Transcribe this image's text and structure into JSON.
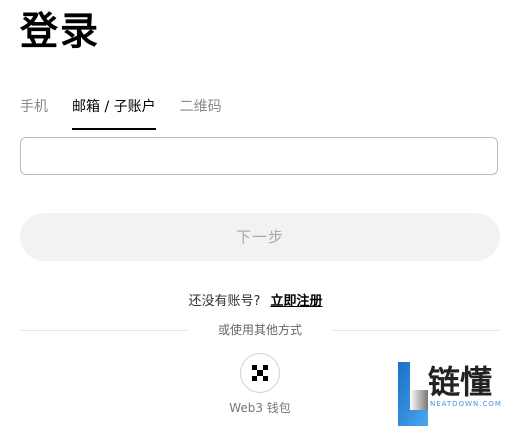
{
  "page": {
    "title": "登录"
  },
  "tabs": [
    {
      "label": "手机",
      "active": false
    },
    {
      "label": "邮箱 / 子账户",
      "active": true
    },
    {
      "label": "二维码",
      "active": false
    }
  ],
  "input": {
    "value": "",
    "placeholder": ""
  },
  "next_button": {
    "label": "下一步",
    "disabled": true
  },
  "register": {
    "prompt": "还没有账号?",
    "link_label": "立即注册"
  },
  "divider": {
    "label": "或使用其他方式"
  },
  "web3_wallet": {
    "icon": "web3-wallet-icon",
    "label": "Web3 钱包"
  },
  "watermark": {
    "text": "链懂",
    "subtext": "NEATDOWN.COM"
  },
  "colors": {
    "button_bg": "#f2f2f2",
    "button_text": "#a8a8a8",
    "tab_inactive": "#888888",
    "tab_active": "#000000",
    "watermark_blue": "#4a90d9"
  }
}
